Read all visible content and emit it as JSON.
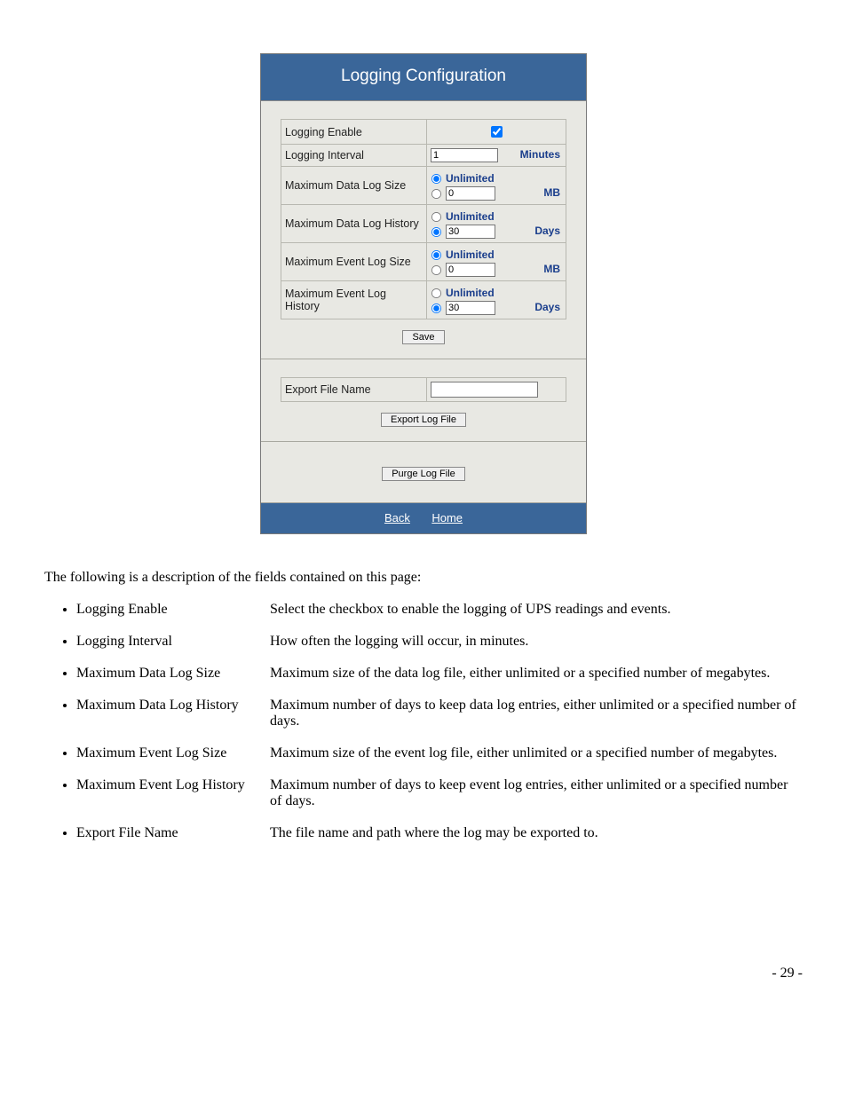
{
  "panel": {
    "title": "Logging Configuration",
    "rows": {
      "loggingEnable": {
        "label": "Logging Enable"
      },
      "loggingInterval": {
        "label": "Logging Interval",
        "value": "1",
        "unit": "Minutes"
      },
      "maxDataLogSize": {
        "label": "Maximum Data Log Size",
        "unlimited": "Unlimited",
        "value": "0",
        "unit": "MB"
      },
      "maxDataLogHistory": {
        "label": "Maximum Data Log History",
        "unlimited": "Unlimited",
        "value": "30",
        "unit": "Days"
      },
      "maxEventLogSize": {
        "label": "Maximum Event Log Size",
        "unlimited": "Unlimited",
        "value": "0",
        "unit": "MB"
      },
      "maxEventLogHistory": {
        "label": "Maximum Event Log History",
        "unlimited": "Unlimited",
        "value": "30",
        "unit": "Days"
      },
      "exportFileName": {
        "label": "Export File Name",
        "value": ""
      }
    },
    "buttons": {
      "save": "Save",
      "export": "Export Log File",
      "purge": "Purge Log File"
    },
    "footer": {
      "back": "Back",
      "home": "Home"
    }
  },
  "description": {
    "intro": "The following is a description of the fields contained on this page:",
    "items": [
      {
        "term": "Logging Enable",
        "text": "Select the checkbox to enable the logging of UPS readings and events."
      },
      {
        "term": "Logging Interval",
        "text": "How often the logging will occur, in minutes."
      },
      {
        "term": "Maximum Data Log Size",
        "text": "Maximum size of the data log file, either unlimited or a specified number of megabytes."
      },
      {
        "term": "Maximum Data Log History",
        "text": "Maximum number of days to keep data log entries, either unlimited or a specified number of days."
      },
      {
        "term": "Maximum Event Log Size",
        "text": "Maximum size of the event log file, either unlimited or a specified number of megabytes."
      },
      {
        "term": "Maximum Event Log History",
        "text": "Maximum number of days to keep event log entries, either unlimited or a specified number of days."
      },
      {
        "term": "Export File Name",
        "text": "The file name and path where the log may be exported to."
      }
    ]
  },
  "pageNumber": "- 29 -"
}
